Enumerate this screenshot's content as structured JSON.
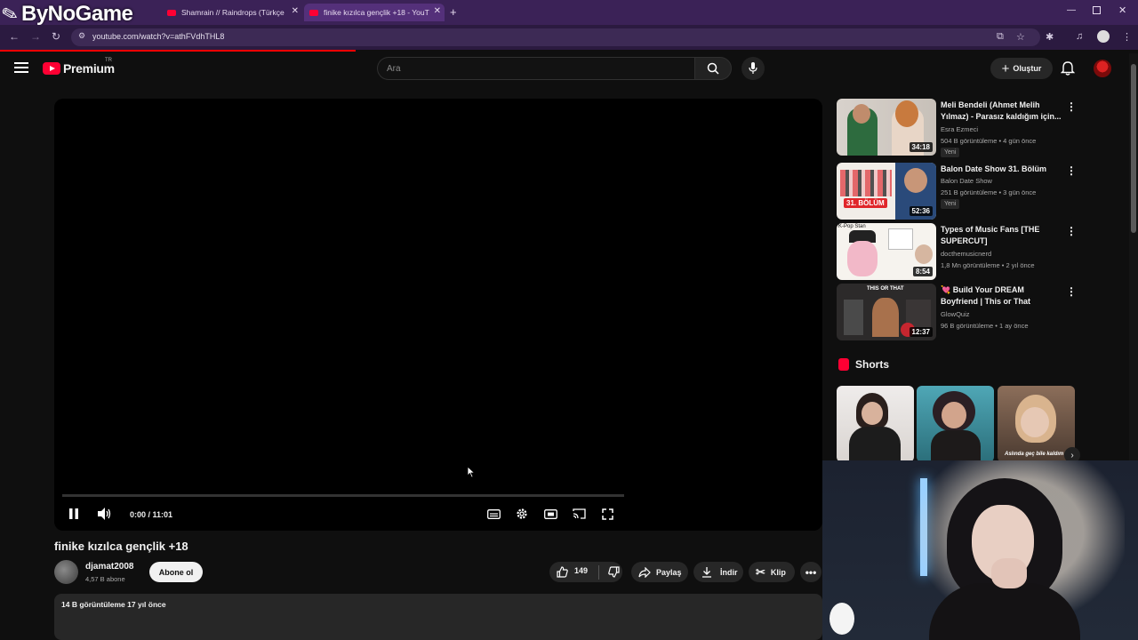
{
  "browser": {
    "tabs": [
      {
        "title": "Shamrain // Raindrops (Türkçe"
      },
      {
        "title": "finike kızılca gençlik +18 - YouT"
      }
    ],
    "url": "youtube.com/watch?v=athFVdhTHL8"
  },
  "overlay": {
    "logo_text": "ByNoGame"
  },
  "header": {
    "logo_word": "Premium",
    "region": "TR",
    "search_placeholder": "Ara",
    "create_label": "Oluştur"
  },
  "player": {
    "time": "0:00 / 11:01"
  },
  "video": {
    "title": "finike kızılca gençlik +18",
    "channel": "djamat2008",
    "subscribers": "4,57 B abone",
    "subscribe_label": "Abone ol",
    "likes": "149",
    "share_label": "Paylaş",
    "download_label": "İndir",
    "clip_label": "Klip",
    "views_age": "14 B görüntüleme  17 yıl önce"
  },
  "recommendations": [
    {
      "title": "Meli Bendeli (Ahmet Melih Yılmaz) - Parasız kaldığım için...",
      "channel": "Esra Ezmeci",
      "meta": "504 B görüntüleme • 4 gün önce",
      "badge": "Yeni",
      "duration": "34:18",
      "thumb_colors": [
        "#c9c3bd",
        "#2d6b3e",
        "#e8d6c7"
      ]
    },
    {
      "title": "Balon Date Show 31. Bölüm",
      "channel": "Balon Date Show",
      "meta": "251 B görüntüleme • 3 gün önce",
      "badge": "Yeni",
      "duration": "52:36",
      "thumb_colors": [
        "#f4f0ec",
        "#e0464a",
        "#2a4a7a"
      ]
    },
    {
      "title": "Types of Music Fans [THE SUPERCUT]",
      "channel": "docthemusicnerd",
      "meta": "1,8 Mn görüntüleme • 2 yıl önce",
      "badge": "",
      "duration": "8:54",
      "thumb_colors": [
        "#f6f3ee",
        "#f2b8c8",
        "#222222"
      ]
    },
    {
      "title": "💘 Build Your DREAM Boyfriend | This or That",
      "channel": "GlowQuiz",
      "meta": "96 B görüntüleme • 1 ay önce",
      "badge": "",
      "duration": "12:37",
      "thumb_colors": [
        "#2c2a2a",
        "#a8714c",
        "#c6262f"
      ]
    }
  ],
  "shorts": {
    "heading": "Shorts",
    "items": [
      {
        "caption": "",
        "colors": [
          "#ebe8e5",
          "#2a1f1c"
        ]
      },
      {
        "caption": "",
        "colors": [
          "#4fa7b6",
          "#2b1f24"
        ]
      },
      {
        "caption": "Aslında geç bile kaldım",
        "colors": [
          "#8c6e5a",
          "#2e2825"
        ]
      }
    ]
  },
  "thumb_labels": {
    "bolum": "31. BÖLÜM",
    "this_or_that": "THIS OR THAT",
    "kpop": "K-Pop Stan"
  }
}
